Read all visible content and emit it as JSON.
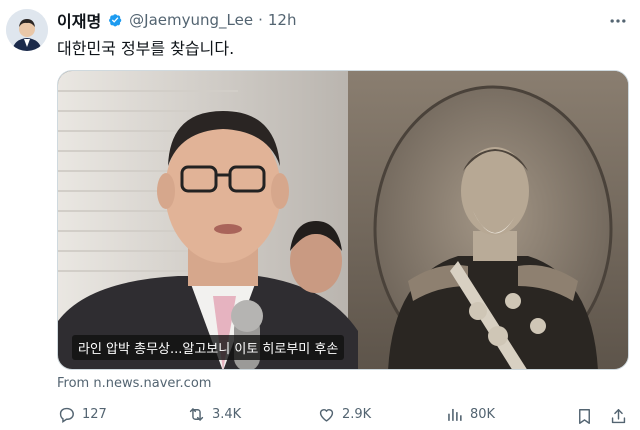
{
  "author": {
    "display_name": "이재명",
    "handle": "@Jaemyung_Lee",
    "separator": "·",
    "timestamp": "12h",
    "verified": true
  },
  "tweet": {
    "text": "대한민국 정부를 찾습니다."
  },
  "media": {
    "caption": "라인 압박 총무상...알고보니 이토 히로부미 후손"
  },
  "link_source": "From n.news.naver.com",
  "actions": {
    "replies": "127",
    "reposts": "3.4K",
    "likes": "2.9K",
    "views": "80K"
  },
  "icons": [
    "verified-badge-icon",
    "more-icon",
    "reply-icon",
    "repost-icon",
    "like-icon",
    "views-icon",
    "bookmark-icon",
    "share-icon"
  ],
  "colors": {
    "verified": "#1d9bf0",
    "muted": "#536471",
    "text": "#0f1419"
  }
}
